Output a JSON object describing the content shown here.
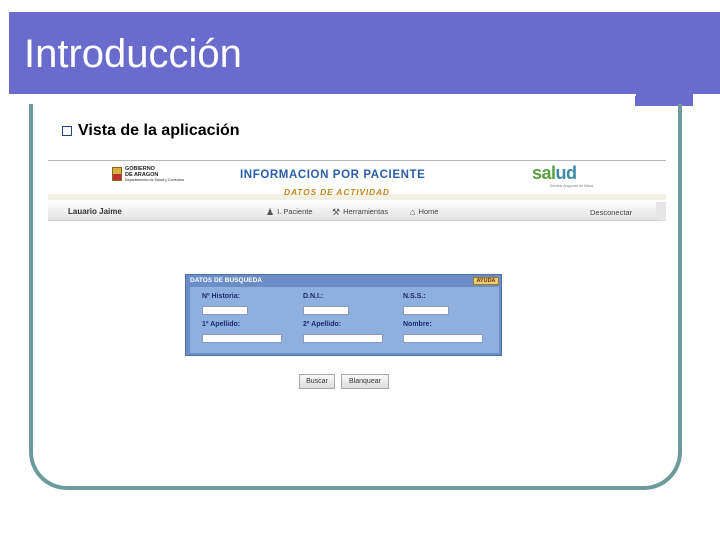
{
  "slide": {
    "title": "Introducción",
    "bullet": "Vista de la aplicación"
  },
  "app": {
    "gov_logo": {
      "line1": "GOBIERNO",
      "line2": "DE ARAGON",
      "sub": "Departamento de Salud y Consumo"
    },
    "title": "INFORMACION POR PACIENTE",
    "subtitle": "DATOS DE ACTIVIDAD",
    "salud_logo": {
      "text_a": "sal",
      "text_b": "ud",
      "sub": "Servicio Aragonés de Salud"
    },
    "nav": {
      "user": "Lauario Jaime",
      "items": [
        {
          "label": "I. Paciente",
          "icon": "person-icon"
        },
        {
          "label": "Herramientas",
          "icon": "tools-icon"
        },
        {
          "label": "Home",
          "icon": "home-icon"
        }
      ],
      "disconnect": "Desconectar"
    },
    "search": {
      "header": "DATOS DE BUSQUEDA",
      "help": "AYUDA",
      "fields": [
        {
          "label": "Nº Historia:",
          "value": ""
        },
        {
          "label": "D.N.I.:",
          "value": ""
        },
        {
          "label": "N.S.S.:",
          "value": ""
        },
        {
          "label": "1º Apellido:",
          "value": ""
        },
        {
          "label": "2º Apellido:",
          "value": ""
        },
        {
          "label": "Nombre:",
          "value": ""
        }
      ]
    },
    "buttons": {
      "search": "Buscar",
      "clear": "Blanquear"
    }
  },
  "colors": {
    "title_bar": "#6b6bce",
    "frame": "#6d9a9a",
    "app_title": "#2a5ea8",
    "app_subtitle": "#c8861a",
    "search_panel": "#6b8ec9"
  }
}
